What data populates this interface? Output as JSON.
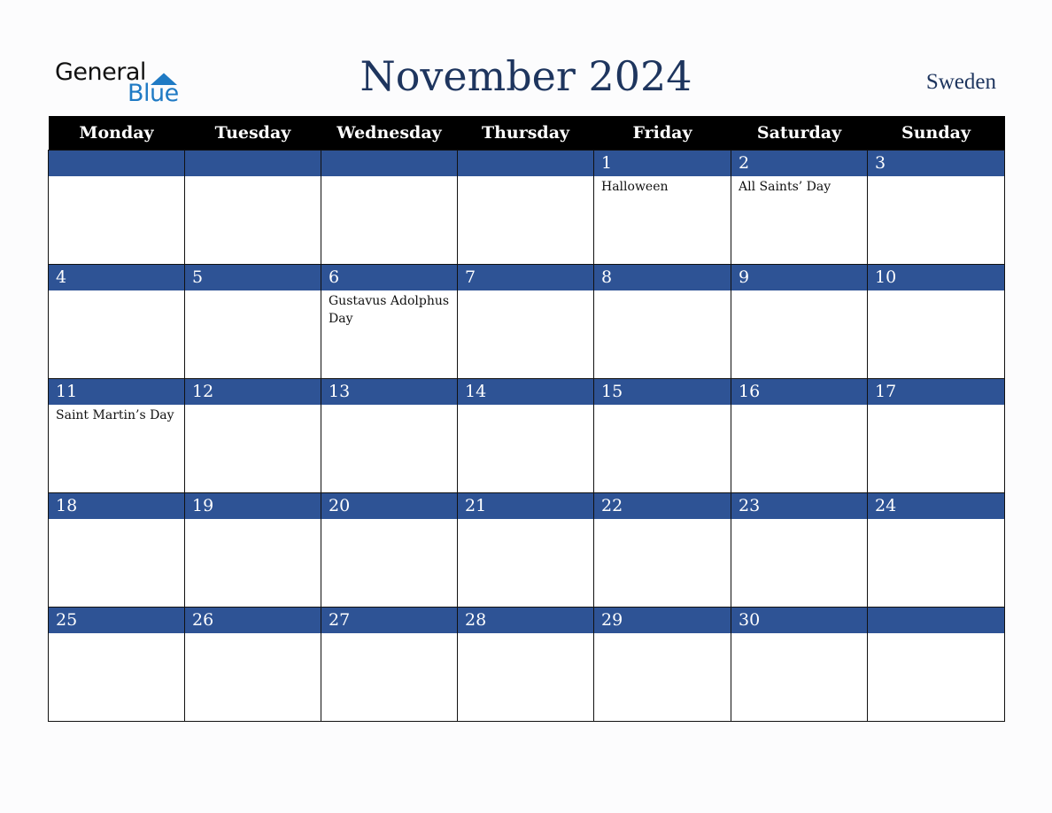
{
  "logo": {
    "word1": "General",
    "word2": "Blue",
    "icon": "triangle-flag-icon"
  },
  "title": "November 2024",
  "country": "Sweden",
  "colors": {
    "header_bg": "#000000",
    "date_bar": "#2e5395",
    "title": "#1e355e",
    "logo_blue": "#1f7ac4"
  },
  "weekdays": [
    "Monday",
    "Tuesday",
    "Wednesday",
    "Thursday",
    "Friday",
    "Saturday",
    "Sunday"
  ],
  "weeks": [
    {
      "days": [
        {
          "date": "",
          "event": ""
        },
        {
          "date": "",
          "event": ""
        },
        {
          "date": "",
          "event": ""
        },
        {
          "date": "",
          "event": ""
        },
        {
          "date": "1",
          "event": "Halloween"
        },
        {
          "date": "2",
          "event": "All Saints’ Day"
        },
        {
          "date": "3",
          "event": ""
        }
      ]
    },
    {
      "days": [
        {
          "date": "4",
          "event": ""
        },
        {
          "date": "5",
          "event": ""
        },
        {
          "date": "6",
          "event": "Gustavus Adolphus Day"
        },
        {
          "date": "7",
          "event": ""
        },
        {
          "date": "8",
          "event": ""
        },
        {
          "date": "9",
          "event": ""
        },
        {
          "date": "10",
          "event": ""
        }
      ]
    },
    {
      "days": [
        {
          "date": "11",
          "event": "Saint Martin’s Day"
        },
        {
          "date": "12",
          "event": ""
        },
        {
          "date": "13",
          "event": ""
        },
        {
          "date": "14",
          "event": ""
        },
        {
          "date": "15",
          "event": ""
        },
        {
          "date": "16",
          "event": ""
        },
        {
          "date": "17",
          "event": ""
        }
      ]
    },
    {
      "days": [
        {
          "date": "18",
          "event": ""
        },
        {
          "date": "19",
          "event": ""
        },
        {
          "date": "20",
          "event": ""
        },
        {
          "date": "21",
          "event": ""
        },
        {
          "date": "22",
          "event": ""
        },
        {
          "date": "23",
          "event": ""
        },
        {
          "date": "24",
          "event": ""
        }
      ]
    },
    {
      "days": [
        {
          "date": "25",
          "event": ""
        },
        {
          "date": "26",
          "event": ""
        },
        {
          "date": "27",
          "event": ""
        },
        {
          "date": "28",
          "event": ""
        },
        {
          "date": "29",
          "event": ""
        },
        {
          "date": "30",
          "event": ""
        },
        {
          "date": "",
          "event": ""
        }
      ]
    }
  ]
}
